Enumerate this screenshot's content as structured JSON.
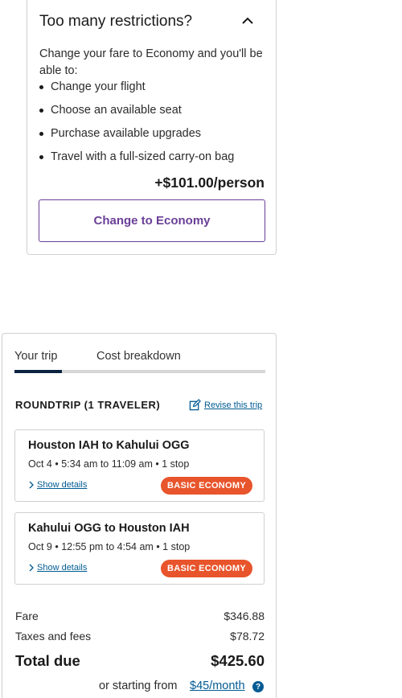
{
  "restrictions": {
    "title": "Too many restrictions?",
    "description": "Change your fare to Economy and you'll be able to:",
    "benefits": [
      "Change your flight",
      "Choose an available seat",
      "Purchase available upgrades",
      "Travel with a full-sized carry-on bag"
    ],
    "price": "+$101.00/person",
    "button_label": "Change to Economy",
    "collapse_icon": "chevron-up-icon"
  },
  "tabs": {
    "your_trip": "Your trip",
    "cost_breakdown": "Cost breakdown",
    "active": "Your trip"
  },
  "trip": {
    "heading": "ROUNDTRIP (1 TRAVELER)",
    "revise_label": "Revise this trip",
    "revise_icon": "edit-icon",
    "flights": [
      {
        "route": "Houston IAH to Kahului OGG",
        "times": "Oct 4 • 5:34 am to 11:09 am • 1 stop",
        "details_label": "Show details",
        "badge": "BASIC ECONOMY"
      },
      {
        "route": "Kahului OGG to Houston IAH",
        "times": "Oct 9 • 12:55 pm to 4:54 am • 1 stop",
        "details_label": "Show details",
        "badge": "BASIC ECONOMY"
      }
    ]
  },
  "costs": {
    "fare_label": "Fare",
    "fare_value": "$346.88",
    "taxes_label": "Taxes and fees",
    "taxes_value": "$78.72",
    "total_label": "Total due",
    "total_value": "$425.60"
  },
  "financing": {
    "prefix": "or starting from",
    "link": "$45/month",
    "help_icon": "?"
  },
  "colors": {
    "accent_purple": "#6a3f97",
    "link_blue": "#005b94",
    "badge_orange": "#e8542b",
    "tab_active": "#0c2340"
  }
}
